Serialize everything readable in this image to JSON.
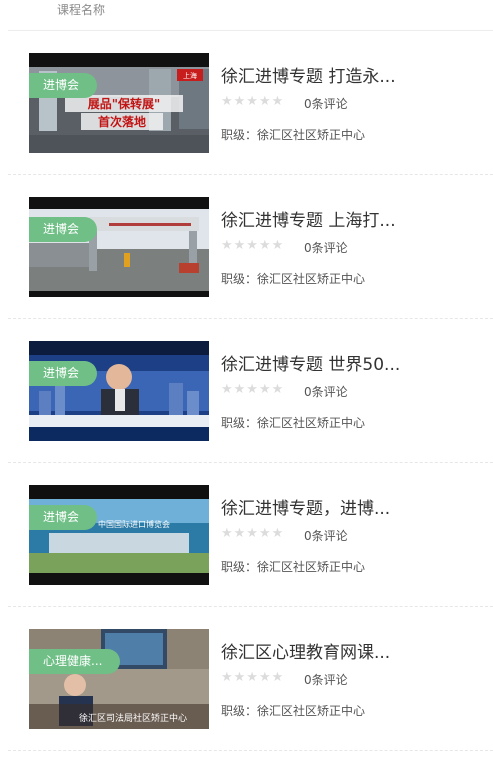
{
  "header": {
    "title": "课程名称"
  },
  "courses": [
    {
      "tag": "进博会",
      "title": "徐汇进博专题 打造永...",
      "comments": "0条评论",
      "level": "职级：徐汇区社区矫正中心",
      "thumb_text": [
        "展品\"保转展\"",
        "首次落地",
        "上海"
      ],
      "stars_icon": "star-icon"
    },
    {
      "tag": "进博会",
      "title": "徐汇进博专题 上海打...",
      "comments": "0条评论",
      "level": "职级：徐汇区社区矫正中心",
      "thumb_text": [],
      "stars_icon": "star-icon"
    },
    {
      "tag": "进博会",
      "title": "徐汇进博专题 世界50...",
      "comments": "0条评论",
      "level": "职级：徐汇区社区矫正中心",
      "thumb_text": [],
      "stars_icon": "star-icon"
    },
    {
      "tag": "进博会",
      "title": "徐汇进博专题，进博...",
      "comments": "0条评论",
      "level": "职级：徐汇区社区矫正中心",
      "thumb_text": [
        "中国国际进口博览会"
      ],
      "stars_icon": "star-icon"
    },
    {
      "tag": "心理健康...",
      "title": "徐汇区心理教育网课...",
      "comments": "0条评论",
      "level": "职级：徐汇区社区矫正中心",
      "thumb_text": [
        "徐汇区司法局社区矫正中心"
      ],
      "stars_icon": "star-icon"
    }
  ],
  "colors": {
    "tag_bg": "#6fbf86",
    "star": "#dcdcdc",
    "divider": "#e7e7e7"
  }
}
